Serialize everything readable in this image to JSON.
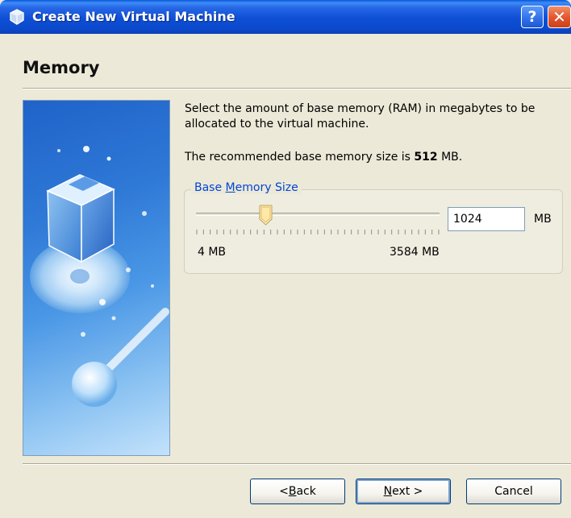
{
  "window": {
    "title": "Create New Virtual Machine",
    "help_label": "?",
    "close_label": "✕"
  },
  "page": {
    "title": "Memory",
    "description": "Select the amount of base memory (RAM) in megabytes to be allocated to the virtual machine.",
    "recommended_prefix": "The recommended base memory size is ",
    "recommended_value": "512",
    "recommended_suffix": " MB."
  },
  "memory": {
    "group_label_pre": "Base ",
    "group_label_accel": "M",
    "group_label_post": "emory Size",
    "slider_min_label": "4 MB",
    "slider_max_label": "3584 MB",
    "slider_fraction": 0.285,
    "value": "1024",
    "unit": "MB"
  },
  "buttons": {
    "back_pre": "< ",
    "back_accel": "B",
    "back_post": "ack",
    "next_accel": "N",
    "next_post": "ext >",
    "cancel": "Cancel"
  },
  "colors": {
    "titlebar": "#0b49cb",
    "legend": "#0046d5",
    "dialog_bg": "#ece9d8"
  }
}
